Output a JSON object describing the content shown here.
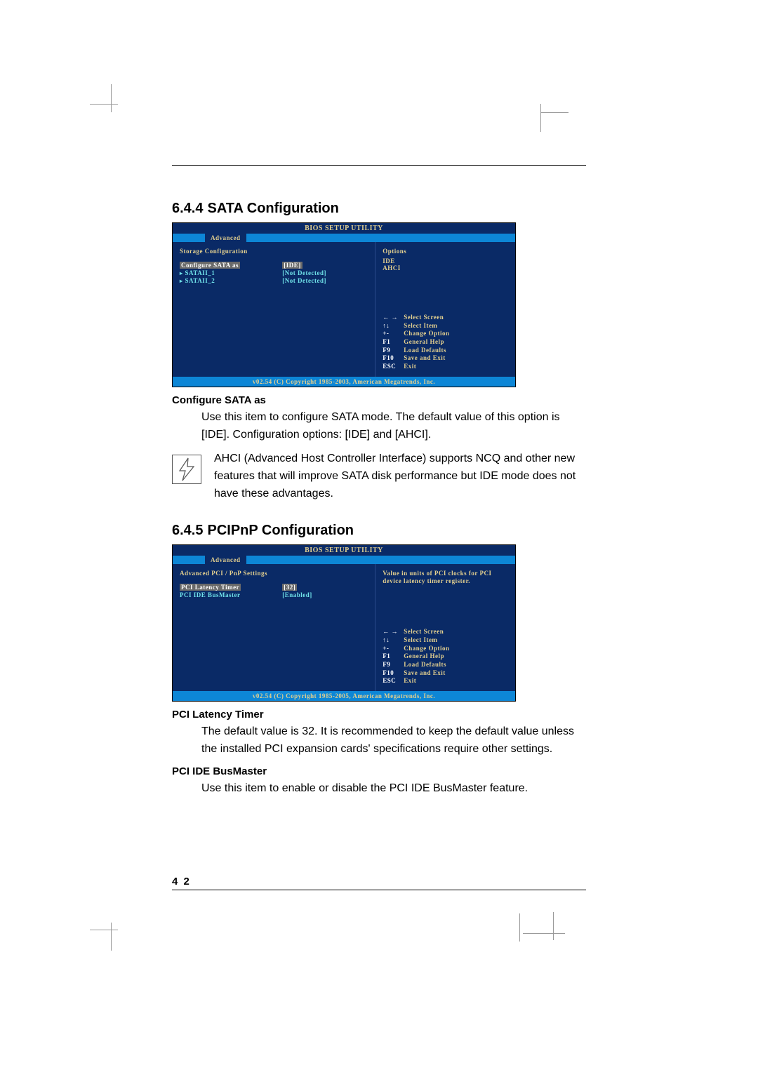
{
  "page_number": "4 2",
  "section_644": {
    "number": "6.4.4",
    "title": "SATA Configuration",
    "bios": {
      "title": "BIOS SETUP UTILITY",
      "tab": "Advanced",
      "panel_title": "Storage Configuration",
      "rows": [
        {
          "label": "Configure SATA as",
          "value": "[IDE]",
          "selected": true
        },
        {
          "label": "SATAII_1",
          "value": "[Not Detected]",
          "arrow": true,
          "cyan": true
        },
        {
          "label": "SATAII_2",
          "value": "[Not Detected]",
          "arrow": true,
          "cyan": true
        }
      ],
      "options_title": "Options",
      "options": [
        "IDE",
        "AHCI"
      ],
      "help": [
        {
          "key": "← →",
          "desc": "Select Screen"
        },
        {
          "key": "↑↓",
          "desc": "Select Item"
        },
        {
          "key": "+-",
          "desc": "Change Option"
        },
        {
          "key": "F1",
          "desc": "General Help"
        },
        {
          "key": "F9",
          "desc": "Load Defaults"
        },
        {
          "key": "F10",
          "desc": "Save and Exit"
        },
        {
          "key": "ESC",
          "desc": "Exit"
        }
      ],
      "footer": "v02.54 (C) Copyright 1985-2003, American Megatrends, Inc."
    },
    "sub1_title": "Configure SATA as",
    "sub1_body": "Use this item to configure SATA mode. The default value of this option is [IDE]. Configuration options: [IDE] and [AHCI].",
    "note": "AHCI (Advanced Host Controller Interface) supports NCQ and other new features that will improve SATA disk performance but IDE mode does not have these advantages."
  },
  "section_645": {
    "number": "6.4.5",
    "title": "PCIPnP Configuration",
    "bios": {
      "title": "BIOS SETUP UTILITY",
      "tab": "Advanced",
      "panel_title": "Advanced PCI / PnP Settings",
      "rows": [
        {
          "label": "PCI Latency Timer",
          "value": "[32]",
          "selected": true
        },
        {
          "label": "PCI IDE BusMaster",
          "value": "[Enabled]"
        }
      ],
      "right_body": "Value in units of PCI clocks for PCI device latency timer register.",
      "help": [
        {
          "key": "← →",
          "desc": "Select Screen"
        },
        {
          "key": "↑↓",
          "desc": "Select Item"
        },
        {
          "key": "+-",
          "desc": "Change Option"
        },
        {
          "key": "F1",
          "desc": "General Help"
        },
        {
          "key": "F9",
          "desc": "Load Defaults"
        },
        {
          "key": "F10",
          "desc": "Save and Exit"
        },
        {
          "key": "ESC",
          "desc": "Exit"
        }
      ],
      "footer": "v02.54 (C) Copyright 1985-2005, American Megatrends, Inc."
    },
    "sub1_title": "PCI Latency Timer",
    "sub1_body": "The default value is 32. It is recommended to keep the default value unless the installed PCI expansion cards' specifications require other settings.",
    "sub2_title": "PCI IDE BusMaster",
    "sub2_body": "Use this item to enable or disable the PCI IDE BusMaster feature."
  }
}
